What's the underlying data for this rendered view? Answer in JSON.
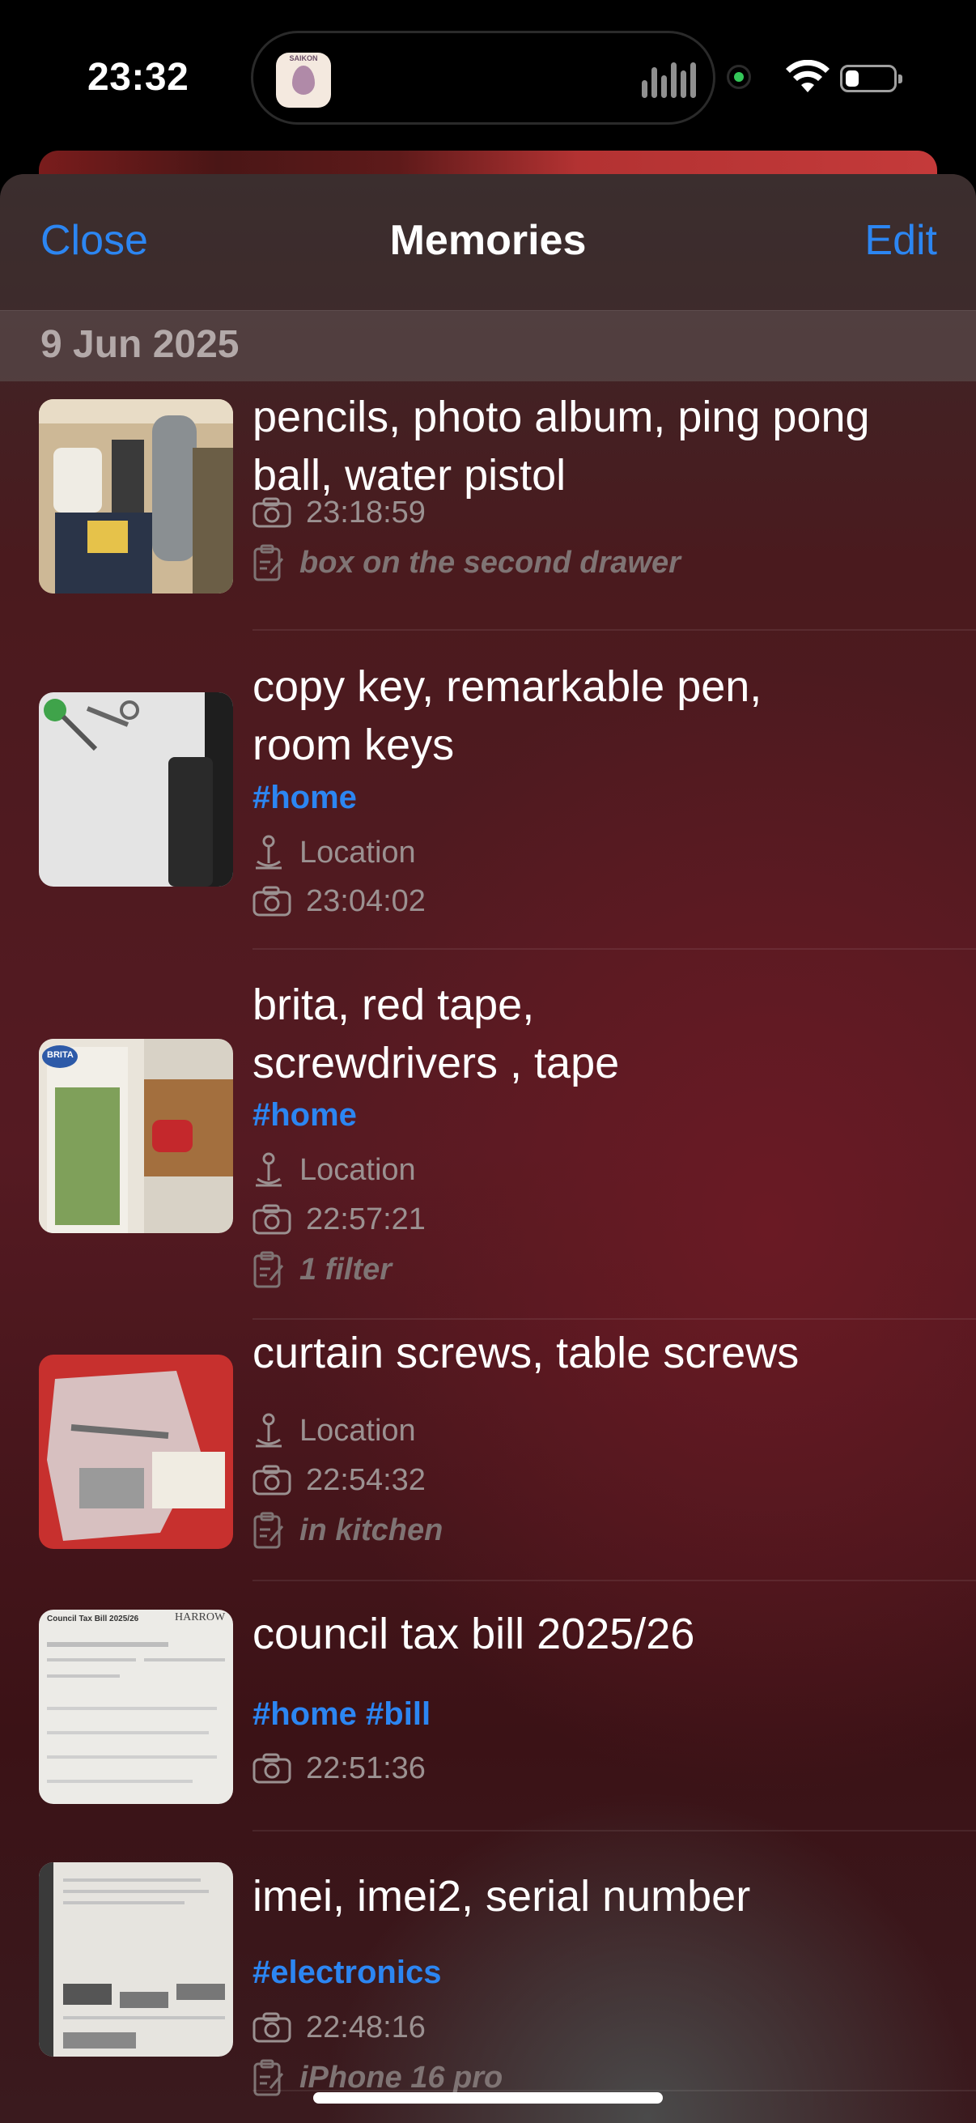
{
  "status_bar": {
    "time": "23:32",
    "app_badge_text": "SAIKON",
    "battery_level": 0.2
  },
  "nav": {
    "close_label": "Close",
    "title": "Memories",
    "edit_label": "Edit"
  },
  "section": {
    "date": "9 Jun 2025"
  },
  "items": [
    {
      "title_line1": "pencils, photo album, ping pong",
      "title_line2": "ball, water pistol",
      "time": "23:18:59",
      "note": "box on the second drawer"
    },
    {
      "title_line1": "copy key, remarkable pen,",
      "title_line2": "room keys",
      "tags": "#home",
      "location": "Location",
      "time": "23:04:02"
    },
    {
      "title_line1": "brita, red tape,",
      "title_line2": "screwdrivers , tape",
      "tags": "#home",
      "location": "Location",
      "time": "22:57:21",
      "note": "1 filter",
      "thumb_brand": "BRITA"
    },
    {
      "title_line1": "curtain screws, table screws",
      "location": "Location",
      "time": "22:54:32",
      "note": "in kitchen"
    },
    {
      "title_line1": "council tax bill 2025/26",
      "tags": "#home #bill",
      "time": "22:51:36",
      "thumb_title": "Council Tax Bill 2025/26",
      "thumb_org": "HARROW"
    },
    {
      "title_line1": "imei, imei2, serial number",
      "tags": "#electronics",
      "time": "22:48:16",
      "note": "iPhone 16 pro"
    }
  ],
  "colors": {
    "accent": "#2c86f2",
    "meta": "#9b9191",
    "note": "#7f7474"
  },
  "icons": {
    "camera": "camera-icon",
    "note": "note-icon",
    "location": "location-pin-icon"
  }
}
